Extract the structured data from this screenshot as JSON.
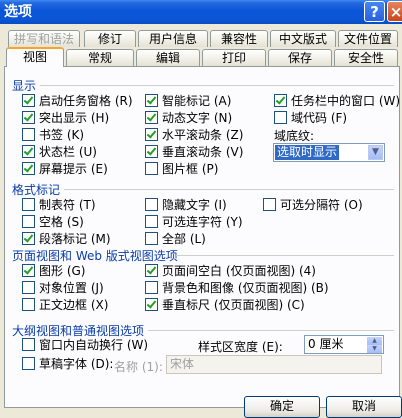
{
  "window": {
    "title": "选项",
    "help_glyph": "?",
    "close_glyph": "×"
  },
  "tabs_row1": [
    "拼写和语法",
    "修订",
    "用户信息",
    "兼容性",
    "中文版式",
    "文件位置"
  ],
  "tabs_row2": [
    "视图",
    "常规",
    "编辑",
    "打印",
    "保存",
    "安全性"
  ],
  "active_tab": "视图",
  "show": {
    "title": "显示",
    "items": [
      {
        "label": "启动任务窗格 (R)",
        "checked": true
      },
      {
        "label": "智能标记 (A)",
        "checked": true
      },
      {
        "label": "任务栏中的窗口 (W)",
        "checked": true
      },
      {
        "label": "突出显示 (H)",
        "checked": true
      },
      {
        "label": "动态文字 (N)",
        "checked": true
      },
      {
        "label": "域代码 (F)",
        "checked": false
      },
      {
        "label": "书签 (K)",
        "checked": false
      },
      {
        "label": "水平滚动条 (Z)",
        "checked": true
      },
      {
        "label": "状态栏 (U)",
        "checked": true
      },
      {
        "label": "垂直滚动条 (V)",
        "checked": true
      },
      {
        "label": "屏幕提示 (E)",
        "checked": true
      },
      {
        "label": "图片框 (P)",
        "checked": false
      }
    ],
    "shading_label": "域底纹:",
    "shading_value": "选取时显示"
  },
  "format": {
    "title": "格式标记",
    "items": [
      {
        "label": "制表符 (T)",
        "checked": false
      },
      {
        "label": "隐藏文字 (I)",
        "checked": false
      },
      {
        "label": "可选分隔符 (O)",
        "checked": false
      },
      {
        "label": "空格 (S)",
        "checked": false
      },
      {
        "label": "可选连字符 (Y)",
        "checked": false
      },
      {
        "label": "段落标记 (M)",
        "checked": true
      },
      {
        "label": "全部 (L)",
        "checked": false
      }
    ]
  },
  "layout": {
    "title": "页面视图和 Web 版式视图选项",
    "items": [
      {
        "label": "图形 (G)",
        "checked": true
      },
      {
        "label": "页面间空白 (仅页面视图) (4)",
        "checked": true
      },
      {
        "label": "对象位置 (J)",
        "checked": false
      },
      {
        "label": "背景色和图像 (仅页面视图) (B)",
        "checked": false
      },
      {
        "label": "正文边框 (X)",
        "checked": false
      },
      {
        "label": "垂直标尺 (仅页面视图) (C)",
        "checked": true
      }
    ]
  },
  "outline": {
    "title": "大纲视图和普通视图选项",
    "items": [
      {
        "label": "窗口内自动换行 (W)",
        "checked": false
      },
      {
        "label": "草稿字体 (D):",
        "checked": false
      }
    ],
    "style_width_label": "样式区宽度 (E):",
    "style_width_value": "0 厘米",
    "name_label": "名称 (1):",
    "font_value": "宋体"
  },
  "buttons": {
    "ok": "确定",
    "cancel": "取消"
  }
}
